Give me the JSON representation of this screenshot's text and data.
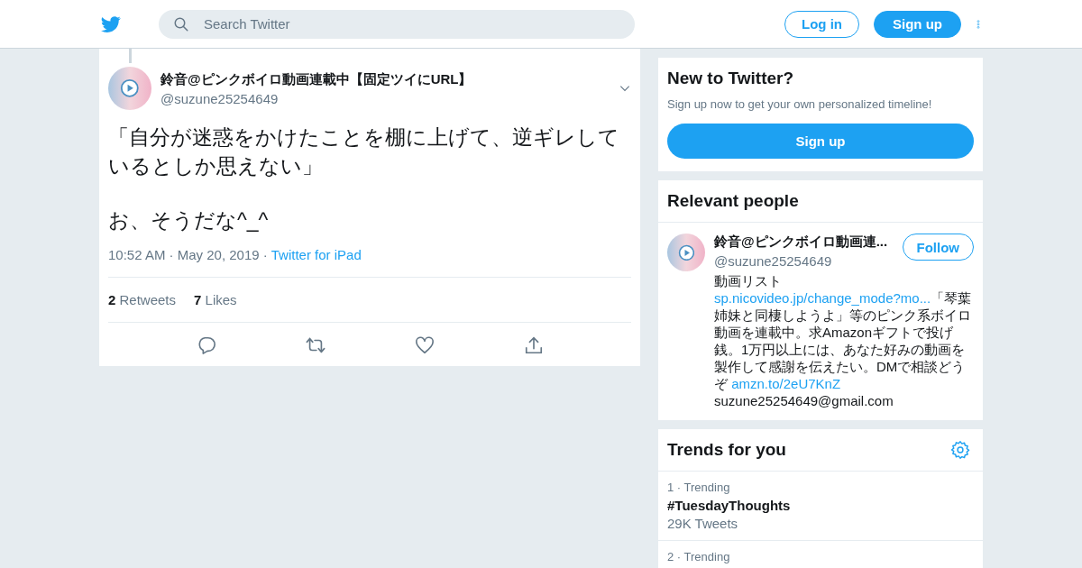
{
  "header": {
    "search": {
      "placeholder": "Search Twitter"
    },
    "buttons": [
      {
        "label": "Log in",
        "kind": "outline"
      },
      {
        "label": "Sign up",
        "kind": "filled"
      }
    ]
  },
  "tweet": {
    "author": {
      "name": "鈴音@ピンクボイロ動画連載中【固定ツイにURL】",
      "handle": "@suzune25254649"
    },
    "text": [
      "「自分が迷惑をかけたことを棚に上げて、逆ギレしているとしか思えない」",
      "お、そうだな^_^"
    ],
    "meta": "10:52 AM · May 20, 2019 ·",
    "source": "Twitter for iPad",
    "stats": [
      "**2** Retweets",
      "**7** Likes"
    ]
  },
  "signup_card": {
    "title": "New to Twitter?",
    "text": "Sign up now to get your own personalized timeline!",
    "button": "Sign up"
  },
  "people_card": {
    "title": "Relevant people",
    "person": {
      "name": "鈴音@ピンクボイロ動画連...",
      "handle": "@suzune25254649",
      "follow": "Follow",
      "bio": [
        {
          "text": "動画リスト ",
          "link": false
        },
        {
          "text": "sp.nicovideo.jp/change_mode?mo...",
          "link": true
        },
        {
          "text": "「琴葉姉妹と同棲しようよ」等のピンク系ボイロ動画を連載中。求Amazonギフトで投げ銭。1万円以上には、あなた好みの動画を製作して感謝を伝えたい。DMで相談どうぞ ",
          "link": false
        },
        {
          "text": "amzn.to/2eU7KnZ",
          "link": true
        },
        {
          "text": "suzune25254649@gmail.com",
          "link": false
        }
      ]
    }
  },
  "trends_card": {
    "title": "Trends for you",
    "trends": [
      {
        "context": "1 · Trending",
        "name": "#TuesdayThoughts",
        "count": "29K Tweets"
      },
      {
        "context": "2 · Trending"
      }
    ]
  }
}
